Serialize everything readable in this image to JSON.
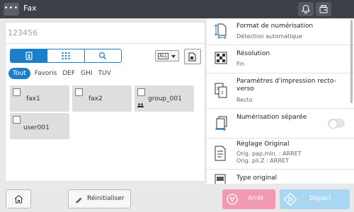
{
  "app": {
    "title": "Fax"
  },
  "top": {
    "menu_icon": "ellipsis-icon",
    "notify_icon": "bell-icon",
    "fax_icon": "fax-phone-icon"
  },
  "destination": {
    "input_placeholder": "123456",
    "view_tabs": [
      "address-book-icon",
      "keypad-icon",
      "search-icon"
    ],
    "type_select": "ALL",
    "filters": [
      "Tout",
      "Favoris",
      "DEF",
      "GHI",
      "TUV"
    ],
    "active_filter": "Tout",
    "entries": [
      {
        "label": "fax1"
      },
      {
        "label": "fax2"
      },
      {
        "label": "group_001",
        "is_group": true
      },
      {
        "label": "user001"
      }
    ]
  },
  "settings": {
    "items": [
      {
        "title": "Format de numérisation",
        "sub": "Détection automatique",
        "icon": "scan-size-icon"
      },
      {
        "title": "Résolution",
        "sub": "Fin",
        "icon": "resolution-icon"
      },
      {
        "title": "Paramètres d'impression recto-verso",
        "sub": "Recto",
        "icon": "duplex-icon"
      },
      {
        "title": "Numérisation séparée",
        "sub": "",
        "icon": "separate-scan-icon",
        "toggle_on": false
      },
      {
        "title": "Réglage Original",
        "sub": "Orig. pap.min. : ARRET",
        "sub2": "Orig. pli.Z : ARRET",
        "icon": "original-setting-icon"
      },
      {
        "title": "Type original",
        "sub": "",
        "icon": "original-type-icon"
      }
    ]
  },
  "bottom": {
    "reset_label": "Réinitialiser",
    "stop_label": "Arrêt",
    "start_label": "Départ"
  },
  "colors": {
    "accent": "#1b7fc9",
    "stop": "#f19ab1",
    "start": "#a9d6f3",
    "topbar": "#3d4046"
  }
}
